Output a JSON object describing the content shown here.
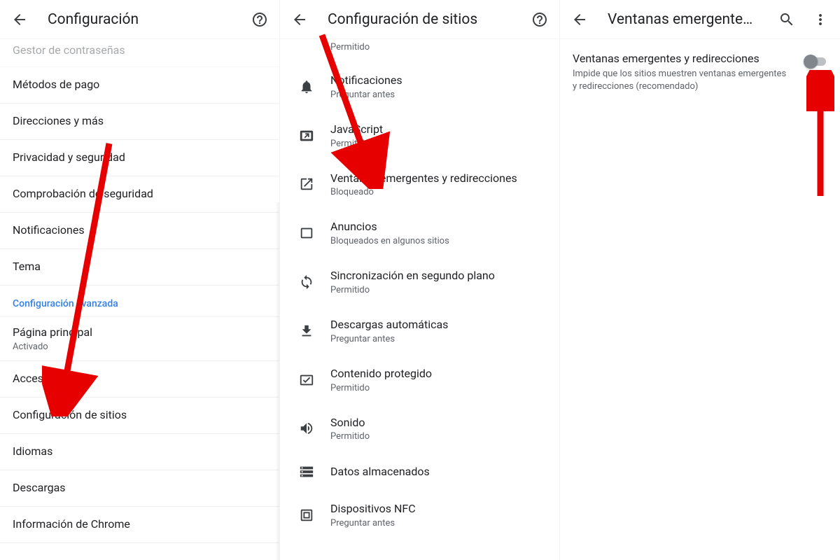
{
  "panel1": {
    "title": "Configuración",
    "cutoff_item": "Gestor de contraseñas",
    "items": [
      {
        "label": "Métodos de pago"
      },
      {
        "label": "Direcciones y más"
      },
      {
        "label": "Privacidad y seguridad"
      },
      {
        "label": "Comprobación de seguridad"
      },
      {
        "label": "Notificaciones"
      },
      {
        "label": "Tema"
      }
    ],
    "section_label": "Configuración avanzada",
    "items2": [
      {
        "label": "Página principal",
        "sub": "Activado"
      },
      {
        "label": "Accesibilidad"
      },
      {
        "label": "Configuración de sitios"
      },
      {
        "label": "Idiomas"
      },
      {
        "label": "Descargas"
      },
      {
        "label": "Información de Chrome"
      }
    ]
  },
  "panel2": {
    "title": "Configuración de sitios",
    "first_sub": "Permitido",
    "items": [
      {
        "icon": "bell",
        "label": "Notificaciones",
        "sub": "Preguntar antes"
      },
      {
        "icon": "js",
        "label": "JavaScript",
        "sub": "Permitido"
      },
      {
        "icon": "popup",
        "label": "Ventanas emergentes y redirecciones",
        "sub": "Bloqueado"
      },
      {
        "icon": "square",
        "label": "Anuncios",
        "sub": "Bloqueados en algunos sitios"
      },
      {
        "icon": "sync",
        "label": "Sincronización en segundo plano",
        "sub": "Permitido"
      },
      {
        "icon": "download",
        "label": "Descargas automáticas",
        "sub": "Preguntar antes"
      },
      {
        "icon": "protected",
        "label": "Contenido protegido",
        "sub": "Permitido"
      },
      {
        "icon": "sound",
        "label": "Sonido",
        "sub": "Permitido"
      },
      {
        "icon": "storage",
        "label": "Datos almacenados",
        "sub": ""
      },
      {
        "icon": "nfc",
        "label": "Dispositivos NFC",
        "sub": "Preguntar antes"
      }
    ]
  },
  "panel3": {
    "title": "Ventanas emergente…",
    "toggle": {
      "label": "Ventanas emergentes y redirecciones",
      "desc": "Impide que los sitios muestren ventanas emergentes y redirecciones (recomendado)",
      "state": "off"
    }
  },
  "icons": {
    "back": "arrow-back-icon",
    "help": "help-icon",
    "search": "search-icon",
    "more": "more-vert-icon"
  }
}
